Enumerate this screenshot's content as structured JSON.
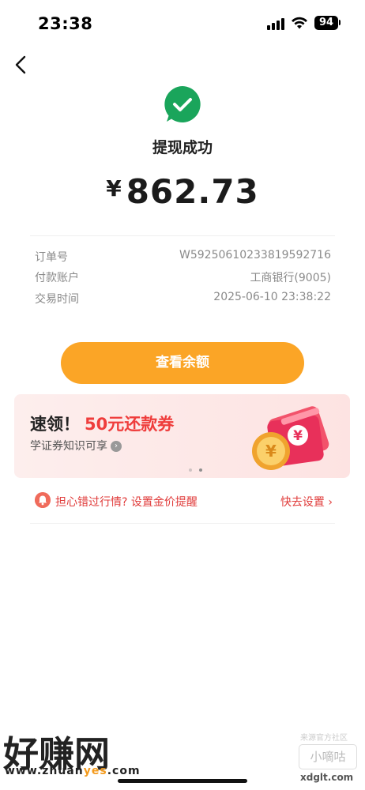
{
  "status_bar": {
    "time": "23:38",
    "battery": "94"
  },
  "result": {
    "title": "提现成功",
    "currency": "¥",
    "amount": "862.73"
  },
  "details": [
    {
      "label": "订单号",
      "value": "W5925061023381959271​6"
    },
    {
      "label": "付款账户",
      "value": "工商银行(9005)"
    },
    {
      "label": "交易时间",
      "value": "2025-06-10 23:38:22"
    }
  ],
  "primary_button": {
    "label": "查看余额"
  },
  "promo_banner": {
    "headline_prefix": "速领！",
    "headline_offer": "50元还款券",
    "subtitle": "学证券知识可享",
    "subtitle_arrow": "›",
    "coin_symbol": "¥"
  },
  "price_alert": {
    "text": "担心错过行情? 设置金价提醒",
    "action": "快去设置 ›"
  },
  "watermarks": {
    "logo": "好赚网",
    "url_prefix": "www.zhuan",
    "url_highlight": "yes",
    "url_suffix": ".com",
    "badge_top": "来源官方社区",
    "badge": "小嘀咕",
    "badge_url": "xdglt.com"
  },
  "colors": {
    "accent": "#fba526",
    "success": "#1aa55b",
    "alert_red": "#e03b3a",
    "banner_bg": "#fdeeed"
  }
}
